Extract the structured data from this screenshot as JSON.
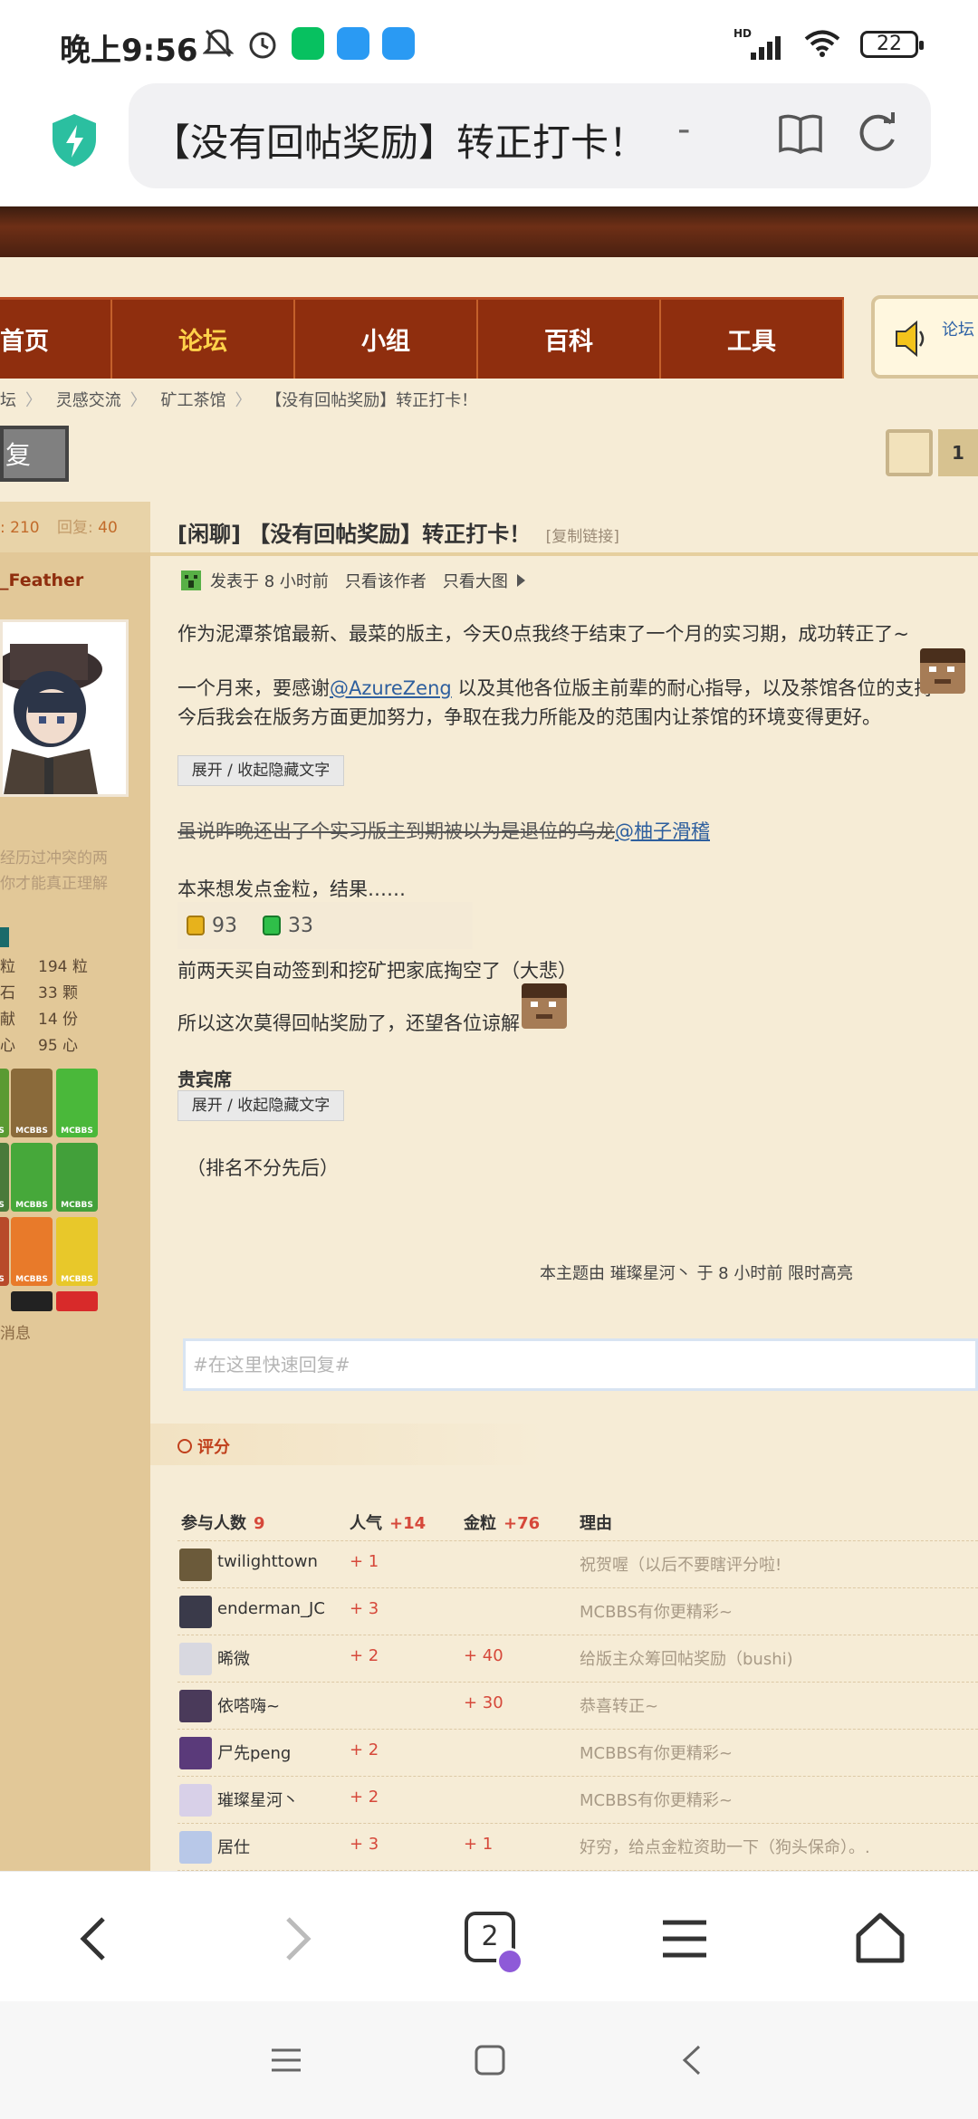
{
  "status": {
    "time": "晚上9:56",
    "battery": "22",
    "hd": "HD"
  },
  "browser": {
    "url_title": "【没有回帖奖励】转正打卡！",
    "url_suffix": "-",
    "tab_count": "2"
  },
  "nav": {
    "items": [
      "首页",
      "论坛",
      "小组",
      "百科",
      "工具"
    ],
    "active": "论坛",
    "notice": "论坛"
  },
  "breadcrumb": [
    "坛",
    "灵感交流",
    "矿工茶馆",
    "【没有回帖奖励】转正打卡！"
  ],
  "reply_button": "复",
  "pager": {
    "page": "1"
  },
  "sidebar": {
    "head_value1": "210",
    "head_label2": "回复:",
    "head_value2": "40",
    "username": "_Feather",
    "quote_line1": "经历过冲突的两",
    "quote_line2": "你才能真正理解",
    "stats": [
      {
        "k": "粒",
        "v": "194 粒"
      },
      {
        "k": "石",
        "v": "33 颗"
      },
      {
        "k": "献",
        "v": "14 份"
      },
      {
        "k": "心",
        "v": "95 心"
      }
    ],
    "messages": "消息",
    "medal_caption": "MCBBS"
  },
  "post": {
    "tag": "[闲聊]",
    "title": "【没有回帖奖励】转正打卡！",
    "copy_link": "[复制链接]",
    "meta_time": "发表于 8 小时前",
    "meta_author_only": "只看该作者",
    "meta_big_image": "只看大图",
    "line1": "作为泥潭茶馆最新、最菜的版主，今天0点我终于结束了一个月的实习期，成功转正了~",
    "line2a": "一个月来，要感谢",
    "line2_mention": "@AzureZeng",
    "line2b": " 以及其他各位版主前辈的耐心指导，以及茶馆各位的支持",
    "line3": "今后我会在版务方面更加努力，争取在我力所能及的范围内让茶馆的环境变得更好。",
    "toggle_hidden": "展开 / 收起隐藏文字",
    "strike_line": "虽说昨晚还出了个实习版主到期被以为是退位的乌龙",
    "strike_mention": "@柚子滑稽",
    "line5": "本来想发点金粒，结果……",
    "gold": "93",
    "emerald": "33",
    "line6": "前两天买自动签到和挖矿把家底掏空了（大悲）",
    "line7": "所以这次莫得回帖奖励了，还望各位谅解",
    "vip_title": "贵宾席",
    "rank_note": "（排名不分先后）",
    "highlight_note": "本主题由 璀璨星河丶 于 8 小时前 限时高亮"
  },
  "quick_reply": {
    "placeholder": "#在这里快速回复#"
  },
  "rating": {
    "title": "评分",
    "head": {
      "participants": "参与人数",
      "participants_count": "9",
      "popularity": "人气",
      "popularity_total": "+14",
      "gold": "金粒",
      "gold_total": "+76",
      "reason": "理由"
    },
    "rows": [
      {
        "name": "twilighttown",
        "pop": "+ 1",
        "gold": "",
        "reason": "祝贺喔（以后不要瞎评分啦!",
        "color": "#6b5a3a"
      },
      {
        "name": "enderman_JC",
        "pop": "+ 3",
        "gold": "",
        "reason": "MCBBS有你更精彩~",
        "color": "#3a3a4a"
      },
      {
        "name": "晞微",
        "pop": "+ 2",
        "gold": "+ 40",
        "reason": "给版主众筹回帖奖励（bushi)",
        "color": "#d8d8e0"
      },
      {
        "name": "依嗒嗨~",
        "pop": "",
        "gold": "+ 30",
        "reason": "恭喜转正~",
        "color": "#4a3a5a"
      },
      {
        "name": "尸先peng",
        "pop": "+ 2",
        "gold": "",
        "reason": "MCBBS有你更精彩~",
        "color": "#5a3a7a"
      },
      {
        "name": "璀璨星河丶",
        "pop": "+ 2",
        "gold": "",
        "reason": "MCBBS有你更精彩~",
        "color": "#d8d0e8"
      },
      {
        "name": "居仕",
        "pop": "+ 3",
        "gold": "+ 1",
        "reason": "好穷，给点金粒资助一下（狗头保命）。.",
        "color": "#b8c8e8"
      }
    ]
  }
}
